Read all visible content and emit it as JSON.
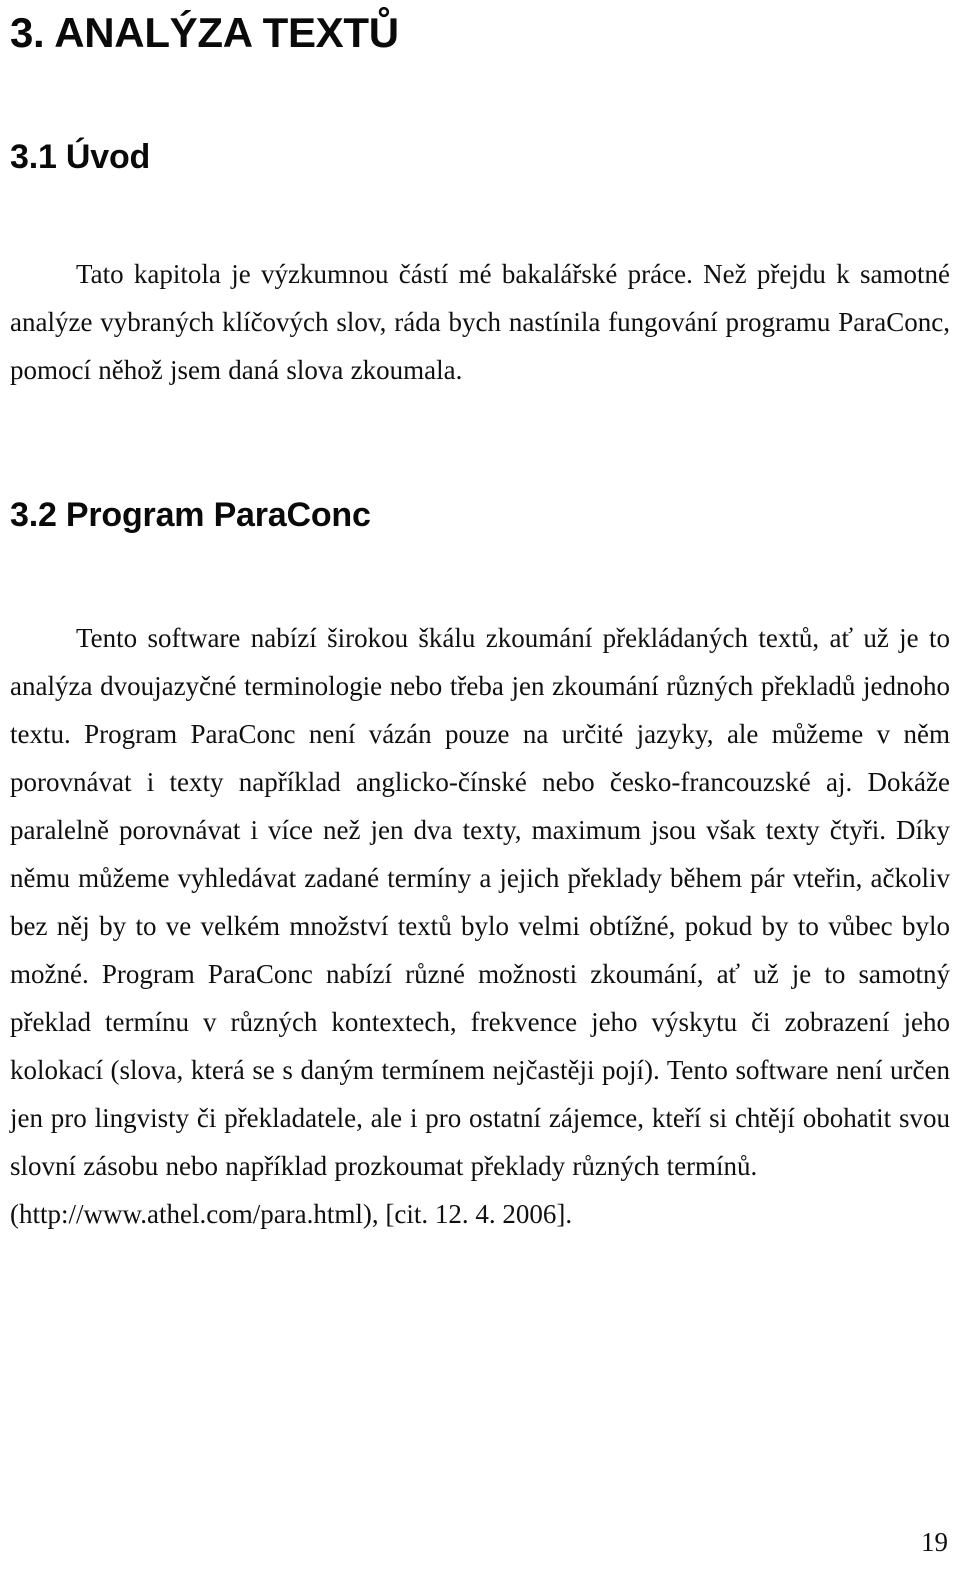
{
  "document": {
    "chapter_heading": "3. ANALÝZA TEXTŮ",
    "section_1": {
      "heading": "3.1 Úvod",
      "paragraph": "Tato kapitola je výzkumnou částí mé bakalářské práce. Než přejdu k samotné analýze vybraných klíčových slov, ráda bych nastínila fungování programu ParaConc, pomocí něhož jsem daná slova zkoumala."
    },
    "section_2": {
      "heading": "3.2 Program ParaConc",
      "paragraph": "Tento software nabízí širokou škálu zkoumání překládaných textů, ať už je to analýza dvoujazyčné terminologie nebo třeba jen zkoumání různých překladů jednoho textu. Program ParaConc není vázán pouze na určité jazyky, ale můžeme v něm porovnávat i texty například anglicko-čínské nebo česko-francouzské aj. Dokáže paralelně porovnávat i více než jen dva texty, maximum jsou však texty čtyři. Díky němu můžeme vyhledávat zadané termíny a jejich překlady během pár vteřin, ačkoliv bez něj by to ve velkém množství textů bylo velmi obtížné, pokud by to vůbec bylo možné. Program ParaConc nabízí různé možnosti zkoumání, ať už je to samotný překlad termínu v různých kontextech, frekvence jeho výskytu či zobrazení jeho kolokací (slova, která se s daným termínem nejčastěji pojí). Tento software není určen jen pro lingvisty či překladatele, ale i pro ostatní zájemce, kteří si chtějí obohatit svou slovní zásobu nebo například prozkoumat překlady různých termínů.",
      "citation": "(http://www.athel.com/para.html), [cit. 12. 4. 2006]."
    }
  },
  "footer": {
    "page_number": "19"
  },
  "colors": {
    "text": "#101010",
    "heading": "#0a0a0a",
    "background": "#ffffff"
  }
}
